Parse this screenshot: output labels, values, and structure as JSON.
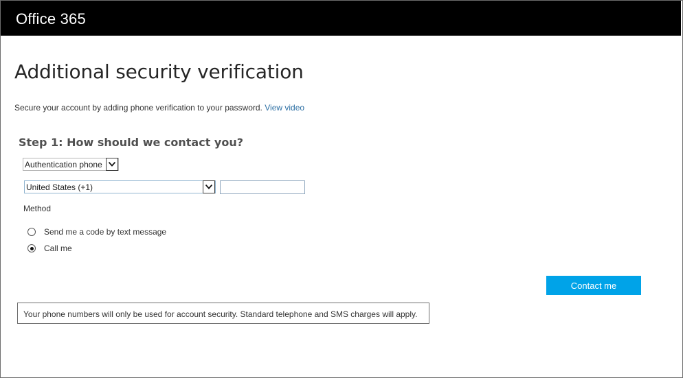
{
  "header": {
    "brand": "Office 365"
  },
  "page": {
    "title": "Additional security verification",
    "description": "Secure your account by adding phone verification to your password.",
    "view_video_link": "View video"
  },
  "step1": {
    "title": "Step 1: How should we contact you?",
    "contact_method_select": "Authentication phone",
    "country_select": "United States (+1)",
    "phone_number_value": "",
    "method_label": "Method",
    "options": [
      {
        "label": "Send me a code by text message",
        "selected": false
      },
      {
        "label": "Call me",
        "selected": true
      }
    ]
  },
  "actions": {
    "contact_me": "Contact me"
  },
  "notice": "Your phone numbers will only be used for account security. Standard telephone and SMS charges will apply."
}
